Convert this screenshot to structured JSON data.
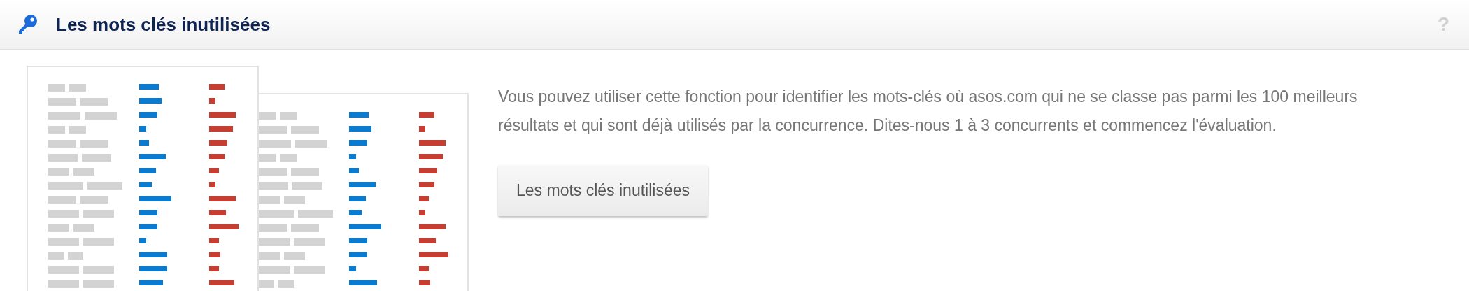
{
  "header": {
    "title": "Les mots clés inutilisées",
    "help_icon": "?"
  },
  "description": "Vous pouvez utiliser cette fonction pour identifier les mots-clés où asos.com qui ne se classe pas parmi les 100 meilleurs résultats et qui sont déjà utilisés par la concurrence. Dites-nous 1 à 3 concurrents et commencez l'évaluation.",
  "button": {
    "label": "Les mots clés inutilisées"
  }
}
